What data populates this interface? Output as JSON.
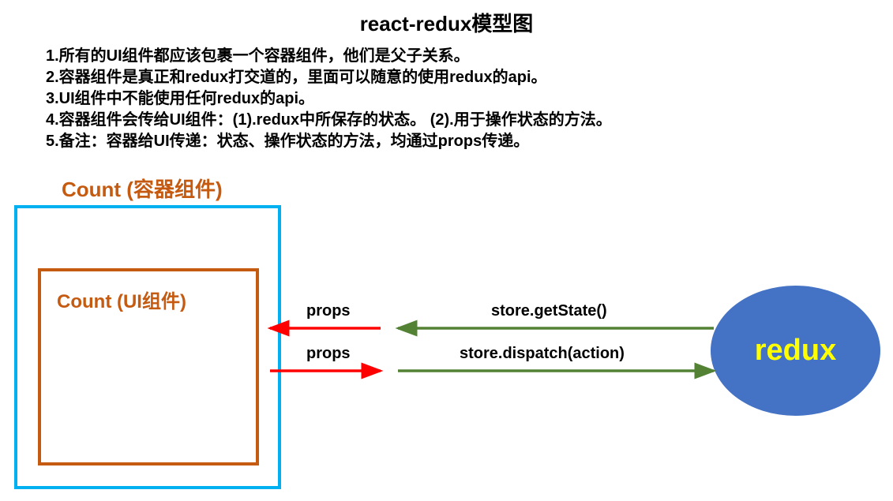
{
  "title": "react-redux模型图",
  "notes": [
    "1.所有的UI组件都应该包裹一个容器组件，他们是父子关系。",
    "2.容器组件是真正和redux打交道的，里面可以随意的使用redux的api。",
    "3.UI组件中不能使用任何redux的api。",
    "4.容器组件会传给UI组件：(1).redux中所保存的状态。  (2).用于操作状态的方法。",
    "5.备注：容器给UI传递：状态、操作状态的方法，均通过props传递。"
  ],
  "diagram": {
    "container_label": "Count (容器组件)",
    "ui_label": "Count (UI组件)",
    "redux_label": "redux",
    "arrow_props_in": "props",
    "arrow_props_out": "props",
    "arrow_getstate": "store.getState()",
    "arrow_dispatch": "store.dispatch(action)"
  },
  "colors": {
    "container_border": "#00b0f0",
    "ui_border": "#c55a11",
    "redux_fill": "#4472c4",
    "redux_text": "#ffff00",
    "red_arrow": "#ff0000",
    "green_arrow": "#548235"
  }
}
